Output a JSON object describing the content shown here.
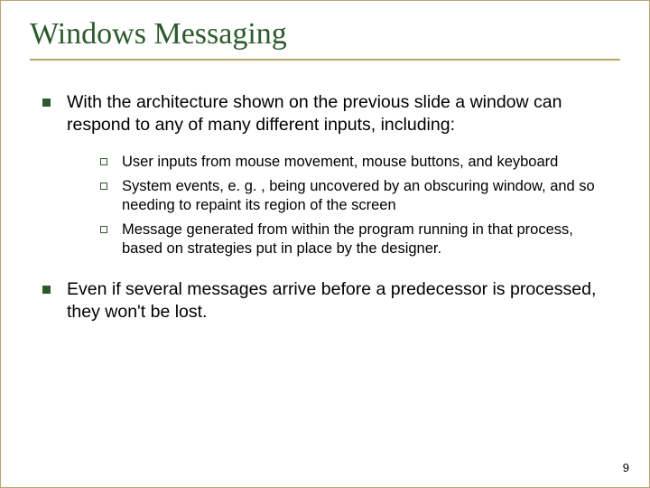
{
  "title": "Windows Messaging",
  "bullets": {
    "b1": "With the architecture shown on the previous slide a window can respond to any of many different inputs, including:",
    "subs": {
      "s1": "User inputs from mouse movement, mouse buttons, and keyboard",
      "s2": "System events, e. g. , being uncovered by an obscuring window, and so needing to repaint its region of the screen",
      "s3": "Message generated from within the program running in that process, based on strategies put in place by the designer."
    },
    "b2": "Even if several messages arrive before a predecessor is processed, they won't be lost."
  },
  "page_number": "9"
}
